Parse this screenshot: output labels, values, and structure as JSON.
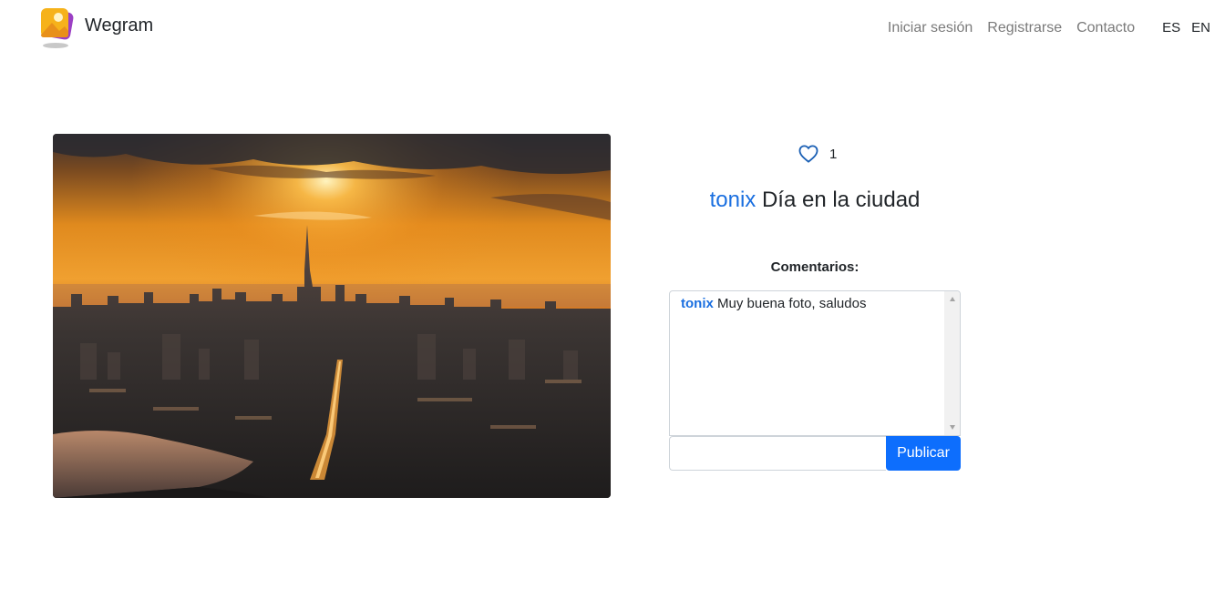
{
  "navbar": {
    "brand_name": "Wegram",
    "links": {
      "login": "Iniciar sesión",
      "register": "Registrarse",
      "contact": "Contacto"
    },
    "languages": {
      "es": "ES",
      "en": "EN"
    }
  },
  "post": {
    "image_icon": "city-sunset-photo",
    "likes": "1",
    "username": "tonix",
    "title": "Día en la ciudad"
  },
  "comments": {
    "label": "Comentarios:",
    "items": [
      {
        "user": "tonix",
        "text": "Muy buena foto, saludos"
      }
    ],
    "input_value": "",
    "publish_label": "Publicar"
  },
  "colors": {
    "accent": "#0d6efd",
    "username": "#1a6fe0",
    "nav_link": "#7a7a7a"
  }
}
